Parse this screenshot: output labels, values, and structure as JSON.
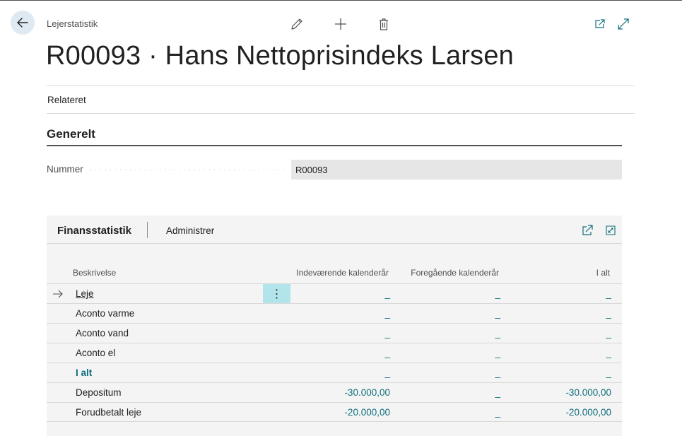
{
  "header": {
    "breadcrumb": "Lejerstatistik",
    "title": "R00093 · Hans Nettoprisindeks Larsen",
    "icons": [
      "back-arrow-icon",
      "edit-pencil-icon",
      "plus-icon",
      "trash-icon",
      "open-new-window-icon",
      "expand-icon"
    ]
  },
  "action_bar": {
    "related": "Relateret"
  },
  "general": {
    "heading": "Generelt",
    "field_label": "Nummer",
    "field_value": "R00093"
  },
  "part": {
    "tabs": [
      "Finansstatistik",
      "Administrer"
    ],
    "columns": [
      "Beskrivelse",
      "Indeværende kalenderår",
      "Foregående kalenderår",
      "I alt"
    ],
    "rows": [
      {
        "desc": "Leje",
        "current": "_",
        "previous": "_",
        "total": "_"
      },
      {
        "desc": "Aconto varme",
        "current": "_",
        "previous": "_",
        "total": "_"
      },
      {
        "desc": "Aconto vand",
        "current": "_",
        "previous": "_",
        "total": "_"
      },
      {
        "desc": "Aconto el",
        "current": "_",
        "previous": "_",
        "total": "_"
      },
      {
        "desc": "I alt",
        "current": "_",
        "previous": "_",
        "total": "_"
      },
      {
        "desc": "Depositum",
        "current": "-30.000,00",
        "previous": "_",
        "total": "-30.000,00"
      },
      {
        "desc": "Forudbetalt leje",
        "current": "-20.000,00",
        "previous": "_",
        "total": "-20.000,00"
      }
    ],
    "row_menu": "⋮"
  },
  "colors": {
    "accent": "#0f6e7d",
    "selected_cell": "#b2e5eb",
    "back_button": "#dfe9f1"
  }
}
